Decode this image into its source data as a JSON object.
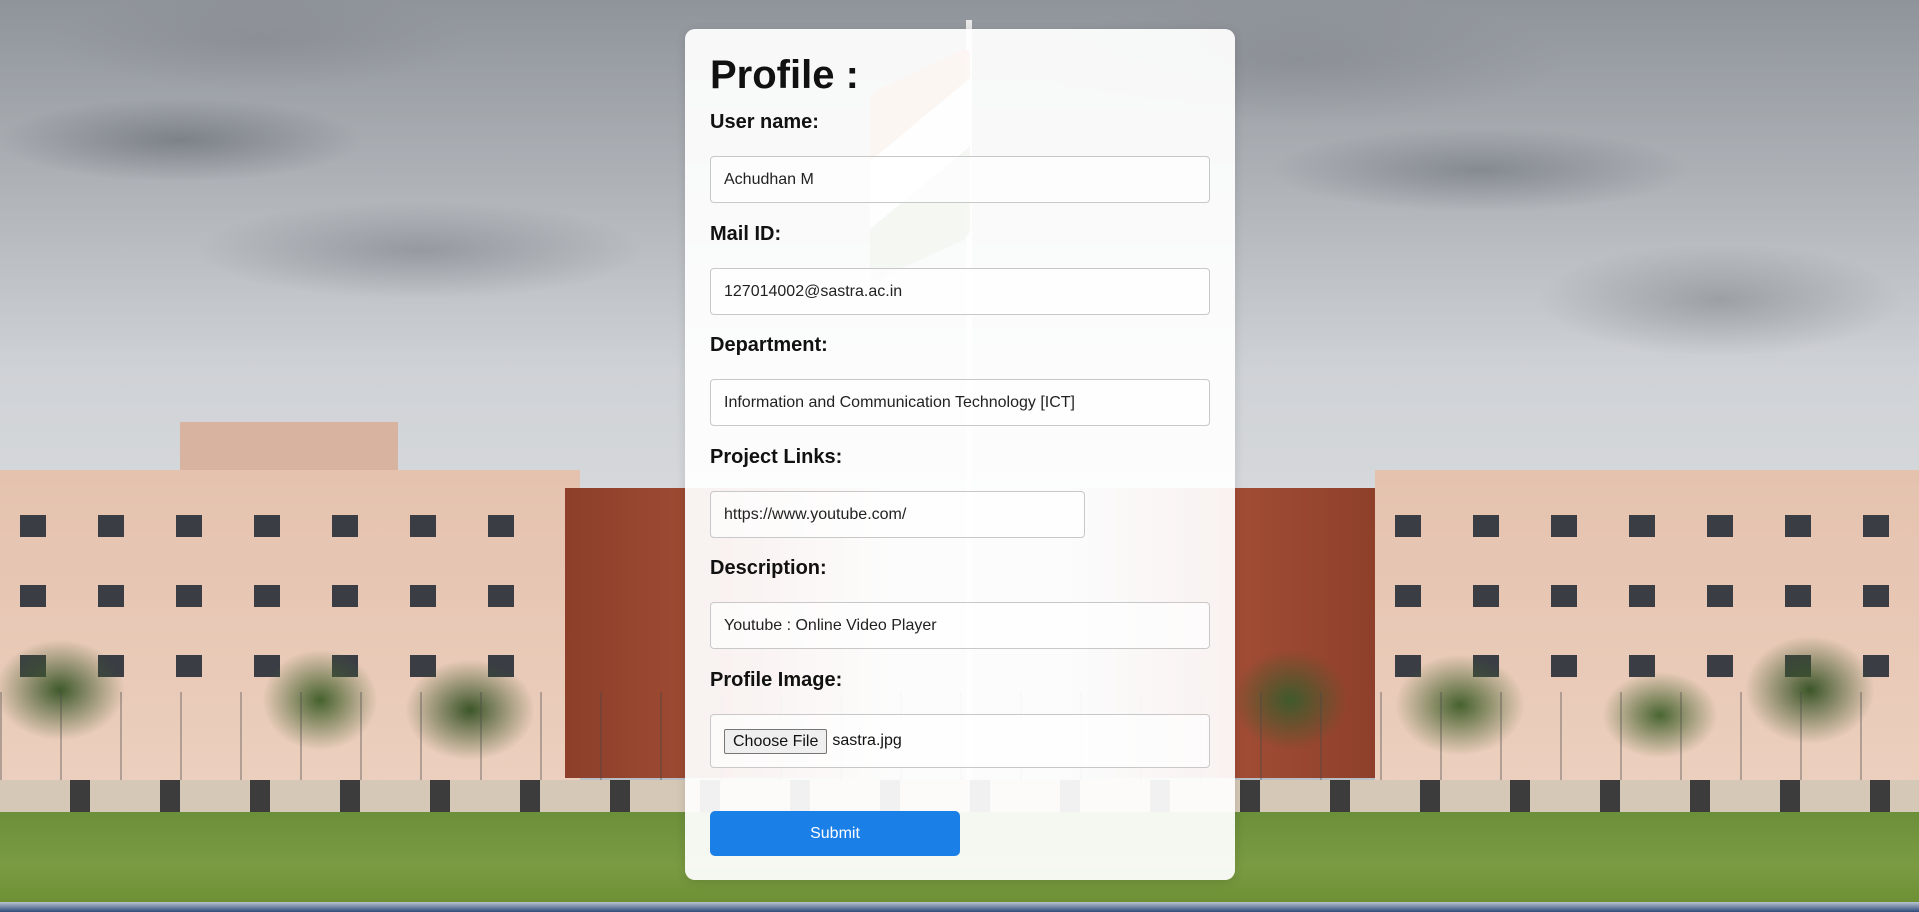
{
  "title": "Profile :",
  "fields": [
    {
      "label": "User name:",
      "value": "Achudhan M"
    },
    {
      "label": "Mail ID:",
      "value": "127014002@sastra.ac.in"
    },
    {
      "label": "Department:",
      "value": "Information and Communication Technology [ICT]"
    },
    {
      "label": "Project Links:",
      "value": "https://www.youtube.com/"
    },
    {
      "label": "Description:",
      "value": "Youtube : Online Video Player"
    }
  ],
  "profile_image": {
    "label": "Profile Image:",
    "button_label": "Choose File",
    "file_name": "sastra.jpg"
  },
  "submit_label": "Submit",
  "colors": {
    "accent": "#1b7fe8",
    "card_bg": "#ffffff"
  }
}
